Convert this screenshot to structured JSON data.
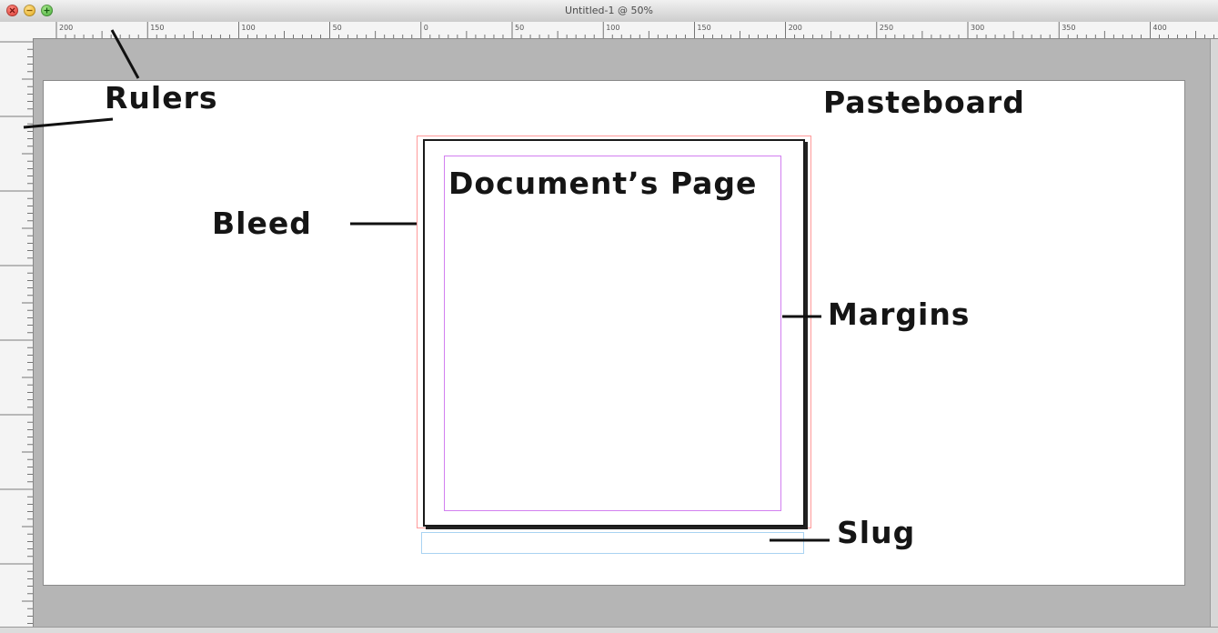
{
  "window": {
    "title": "Untitled-1 @ 50%"
  },
  "labels": {
    "rulers": "Rulers",
    "pasteboard": "Pasteboard",
    "bleed": "Bleed",
    "document_page": "Document’s Page",
    "margins": "Margins",
    "slug": "Slug"
  },
  "ruler": {
    "horizontal_ticks": [
      "200",
      "150",
      "100",
      "50",
      "0",
      "50",
      "100",
      "150",
      "200",
      "250",
      "300",
      "350",
      "400"
    ]
  },
  "colors": {
    "bleed_guide": "#ff9a9a",
    "margin_guide": "#d27ff0",
    "slug_guide": "#a9d3f2",
    "pasteboard": "#ffffff",
    "canvas_gray": "#b5b5b5"
  }
}
